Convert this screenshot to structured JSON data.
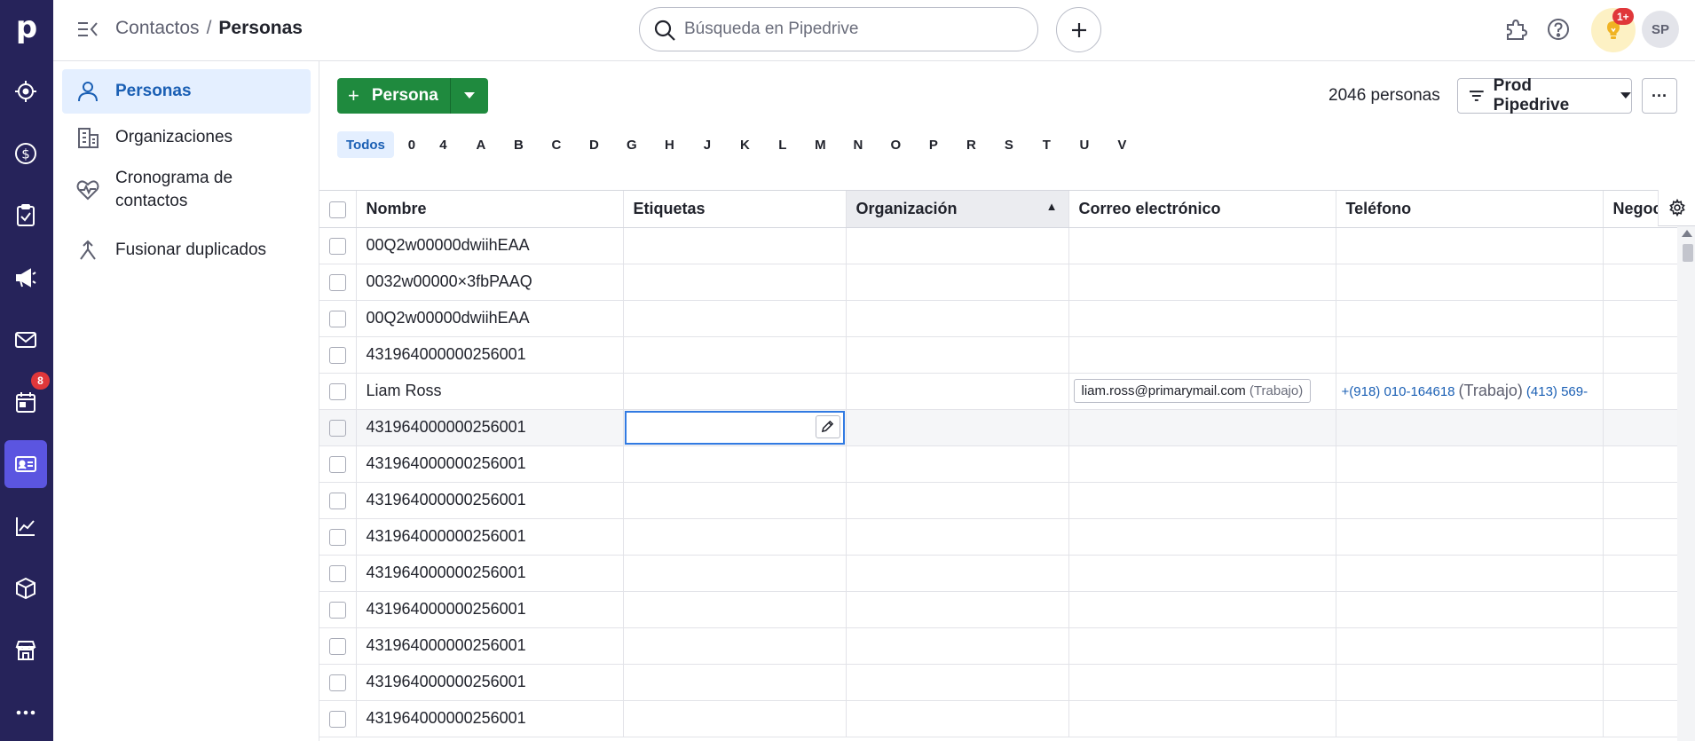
{
  "rail": {
    "logo": "p",
    "calendar_badge": "8",
    "icons": [
      "target-icon",
      "deals-icon",
      "activities-icon",
      "campaigns-icon",
      "mail-icon",
      "calendar-icon",
      "contacts-icon",
      "insights-icon",
      "products-icon",
      "marketplace-icon",
      "more-icon"
    ]
  },
  "topbar": {
    "breadcrumb_parent": "Contactos",
    "breadcrumb_separator": "/",
    "breadcrumb_current": "Personas",
    "search_placeholder": "Búsqueda en Pipedrive",
    "notif_badge": "1+",
    "avatar_initials": "SP"
  },
  "sidenav": {
    "items": [
      {
        "label": "Personas",
        "icon": "person-icon",
        "active": true
      },
      {
        "label": "Organizaciones",
        "icon": "building-icon",
        "active": false
      },
      {
        "label": "Cronograma de contactos",
        "icon": "heart-pulse-icon",
        "active": false
      },
      {
        "label": "Fusionar duplicados",
        "icon": "merge-icon",
        "active": false
      }
    ]
  },
  "toolbar": {
    "add_label": "Persona",
    "count_text": "2046 personas",
    "filter_label": "Prod Pipedrive",
    "more_label": "···"
  },
  "alphabet": [
    "Todos",
    "0",
    "4",
    "A",
    "B",
    "C",
    "D",
    "G",
    "H",
    "J",
    "K",
    "L",
    "M",
    "N",
    "O",
    "P",
    "R",
    "S",
    "T",
    "U",
    "V"
  ],
  "table": {
    "columns": [
      "Nombre",
      "Etiquetas",
      "Organización",
      "Correo electrónico",
      "Teléfono",
      "Negoc"
    ],
    "sorted_column": "Organización",
    "rows": [
      {
        "name": "00Q2w00000dwiihEAA"
      },
      {
        "name": "0032w00000×3fbPAAQ"
      },
      {
        "name": "00Q2w00000dwiihEAA"
      },
      {
        "name": "431964000000256001"
      },
      {
        "name": "Liam Ross",
        "email": "liam.ross@primarymail.com",
        "email_type": "(Trabajo)",
        "phone1": "+(918) 010-164618",
        "phone1_type": "(Trabajo)",
        "phone2": "(413) 569-"
      },
      {
        "name": "431964000000256001",
        "editing": true
      },
      {
        "name": "431964000000256001"
      },
      {
        "name": "431964000000256001"
      },
      {
        "name": "431964000000256001"
      },
      {
        "name": "431964000000256001"
      },
      {
        "name": "431964000000256001"
      },
      {
        "name": "431964000000256001"
      },
      {
        "name": "431964000000256001"
      },
      {
        "name": "431964000000256001"
      }
    ]
  },
  "colors": {
    "rail_bg": "#26235a",
    "rail_active": "#5b55e0",
    "primary_green": "#1f8a3e",
    "link_blue": "#1a5fb4"
  }
}
